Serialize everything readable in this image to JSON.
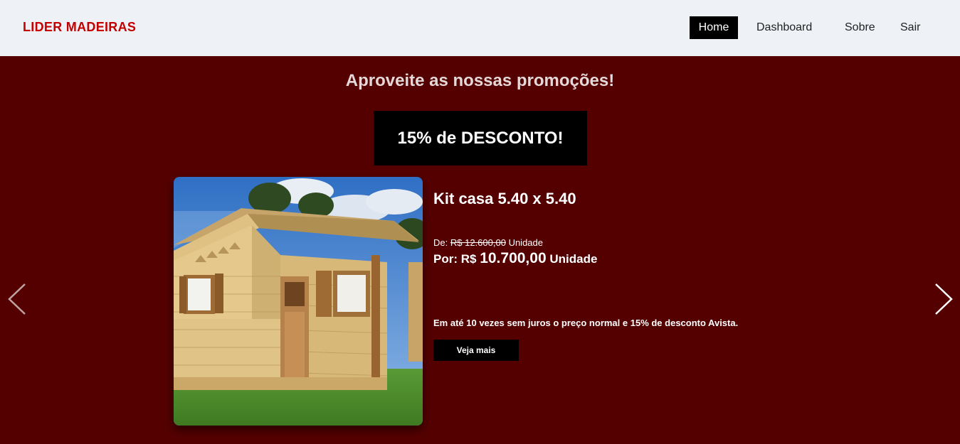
{
  "header": {
    "brand": "LIDER MADEIRAS",
    "nav": {
      "home": "Home",
      "dashboard": "Dashboard",
      "sobre": "Sobre",
      "sair": "Sair"
    }
  },
  "promo": {
    "title": "Aproveite as nossas promoções!",
    "discount_label": "15% de DESCONTO!"
  },
  "product": {
    "name": "Kit casa 5.40 x 5.40",
    "old_price_prefix": "De:",
    "old_price": "R$ 12.600,00",
    "old_price_unit": "Unidade",
    "new_price_prefix": "Por: R$",
    "new_price": "10.700,00",
    "new_price_unit": "Unidade",
    "terms": "Em até 10 vezes sem juros o preço normal e 15% de desconto Avista.",
    "button_label": "Veja mais"
  },
  "colors": {
    "background": "#550000",
    "navbar": "#eef2f7",
    "brand": "#c40000",
    "active_nav": "#000000"
  }
}
